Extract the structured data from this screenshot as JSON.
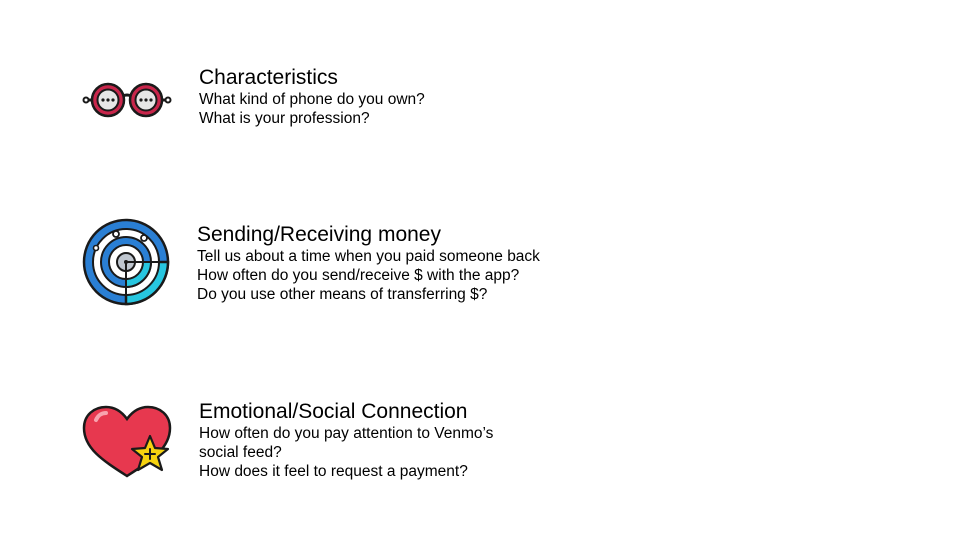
{
  "sections": [
    {
      "icon": "glasses-icon",
      "title": "Characteristics",
      "lines": [
        "What kind of phone do you own?",
        "What is your profession?"
      ]
    },
    {
      "icon": "target-icon",
      "title": "Sending/Receiving money",
      "lines": [
        "Tell us about a time when you paid someone back",
        "How often do you send/receive $ with the app?",
        "Do you use other means of transferring $?"
      ]
    },
    {
      "icon": "heart-star-icon",
      "title": "Emotional/Social Connection",
      "lines": [
        "How often do you pay attention to Venmo’s",
        "social feed?",
        "How does it feel to request a payment?"
      ]
    }
  ],
  "colors": {
    "glasses": "#c8264b",
    "target_blue": "#2a7fd4",
    "target_cyan": "#27c6e0",
    "heart": "#e7384f",
    "star": "#f5d20f",
    "outline": "#1a1a1a"
  }
}
